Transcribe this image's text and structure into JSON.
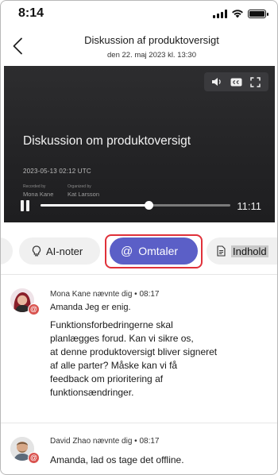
{
  "status_bar": {
    "time": "8:14"
  },
  "header": {
    "title": "Diskussion af produktoversigt",
    "subtitle": "den 22. maj 2023 kl. 13:30"
  },
  "video": {
    "title": "Diskussion om produktoversigt",
    "date": "2023-05-13 02:12 UTC",
    "recorded_by_label": "Recorded by",
    "recorded_by": "Mona Kane",
    "organized_by_label": "Organized by",
    "organized_by": "Kat Larsson",
    "time_remaining": "11:11",
    "progress": 0.57
  },
  "tabs": {
    "ai_notes": "AI-noter",
    "mentions": "Omtaler",
    "content": "Indhold"
  },
  "mentions": [
    {
      "author_line": "Mona Kane nævnte dig • 08:17",
      "first_line": "Amanda Jeg er enig.",
      "paragraph": [
        "Funktionsforbedringerne skal",
        "planlægges forud. Kan vi sikre os,",
        "at denne produktoversigt bliver signeret",
        "af alle parter? Måske kan vi få",
        "feedback om prioritering af",
        "funktionsændringer."
      ]
    },
    {
      "author_line": "David Zhao nævnte dig • 08:17",
      "first_line": "Amanda, lad os tage det offline."
    }
  ],
  "colors": {
    "accent": "#5b5fc7",
    "highlight_ring": "#e0313a",
    "mention_badge": "#d9534f"
  }
}
